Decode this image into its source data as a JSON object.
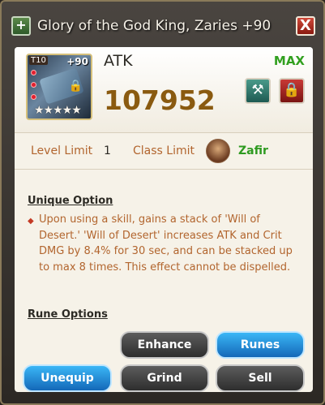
{
  "window": {
    "title": "Glory of the God King, Zaries +90",
    "title_icon": "plus-square-icon",
    "close_label": "X"
  },
  "item": {
    "tier": "T10",
    "enhance": "+90",
    "stars": "★★★★★",
    "icon": "weapon-icon"
  },
  "stat": {
    "name": "ATK",
    "max_label": "MAX",
    "value": "107952"
  },
  "limits": {
    "level_label": "Level Limit",
    "level_value": "1",
    "class_label": "Class Limit",
    "class_value": "Zafir"
  },
  "unique_option": {
    "title": "Unique Option",
    "text": "Upon using a skill, gains a stack of 'Will of Desert.' 'Will of Desert' increases ATK and Crit DMG by 8.4% for 30 sec, and can be stacked up to max 8 times. This effect cannot be dispelled."
  },
  "rune_options": {
    "title": "Rune Options"
  },
  "buttons": {
    "enhance": "Enhance",
    "runes": "Runes",
    "unequip": "Unequip",
    "grind": "Grind",
    "sell": "Sell"
  },
  "colors": {
    "accent_blue": "#1c8ee0",
    "max_green": "#32a020",
    "value_gold": "#8a5a10",
    "label_orange": "#b2652e"
  }
}
